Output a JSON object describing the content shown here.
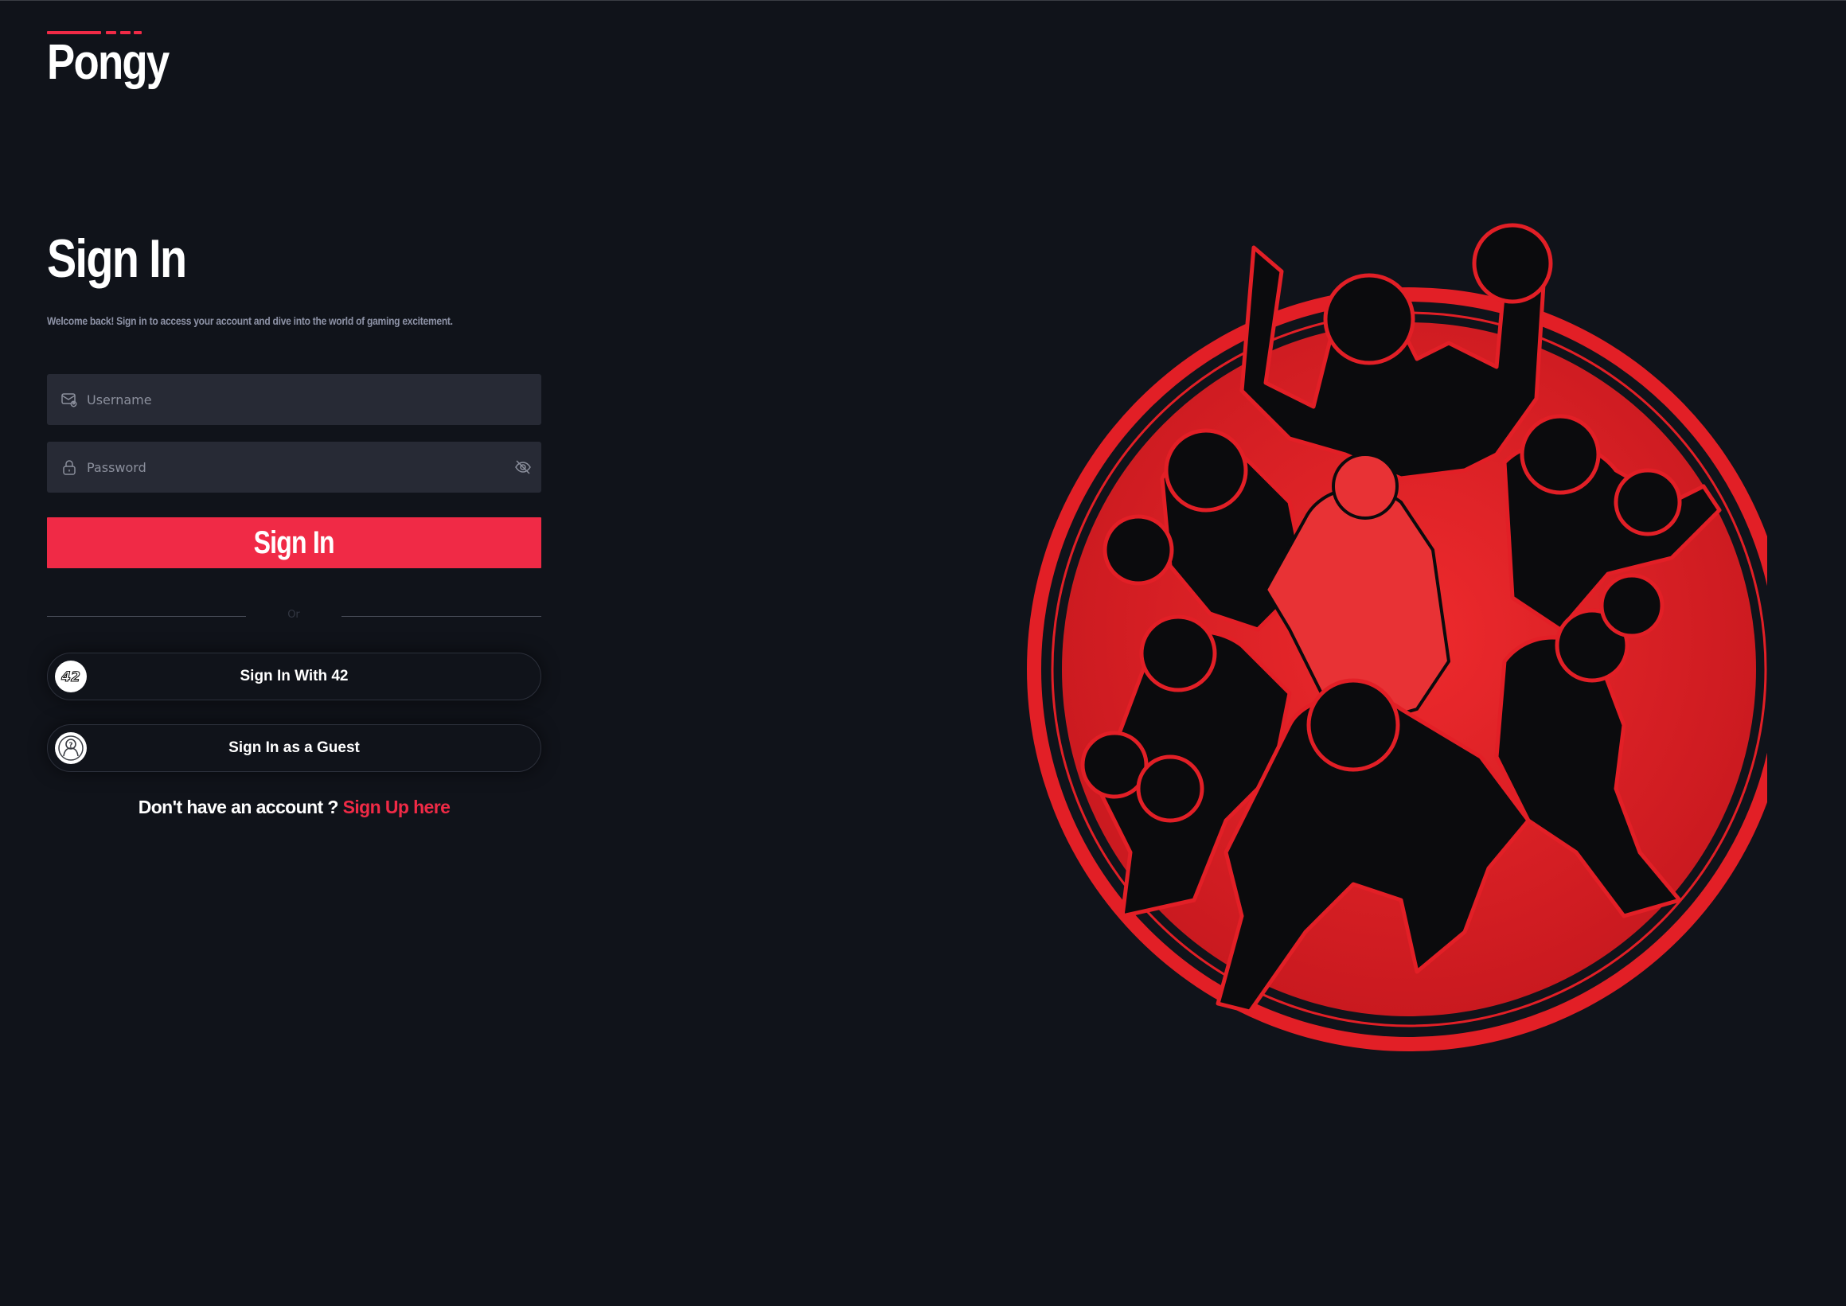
{
  "brand": {
    "name": "Pongy",
    "accent_color": "#f02a46"
  },
  "signin": {
    "title": "Sign In",
    "subtitle": "Welcome back! Sign in to access your account and dive into the world of gaming excitement.",
    "username_placeholder": "Username",
    "password_placeholder": "Password",
    "username_icon": "user-mail-icon",
    "password_icon": "lock-icon",
    "password_toggle_icon": "eye-off-icon",
    "submit_label": "Sign In",
    "divider_text": "Or"
  },
  "oauth": {
    "intra_label": "Sign In With 42",
    "intra_icon": "42-logo-icon",
    "guest_label": "Sign In as a Guest",
    "guest_icon": "guest-question-icon"
  },
  "footer": {
    "question": "Don't have an account ?",
    "signup_link": "Sign Up here"
  },
  "illustration": {
    "icon": "table-tennis-players-illustration",
    "color": "#e21f26"
  }
}
